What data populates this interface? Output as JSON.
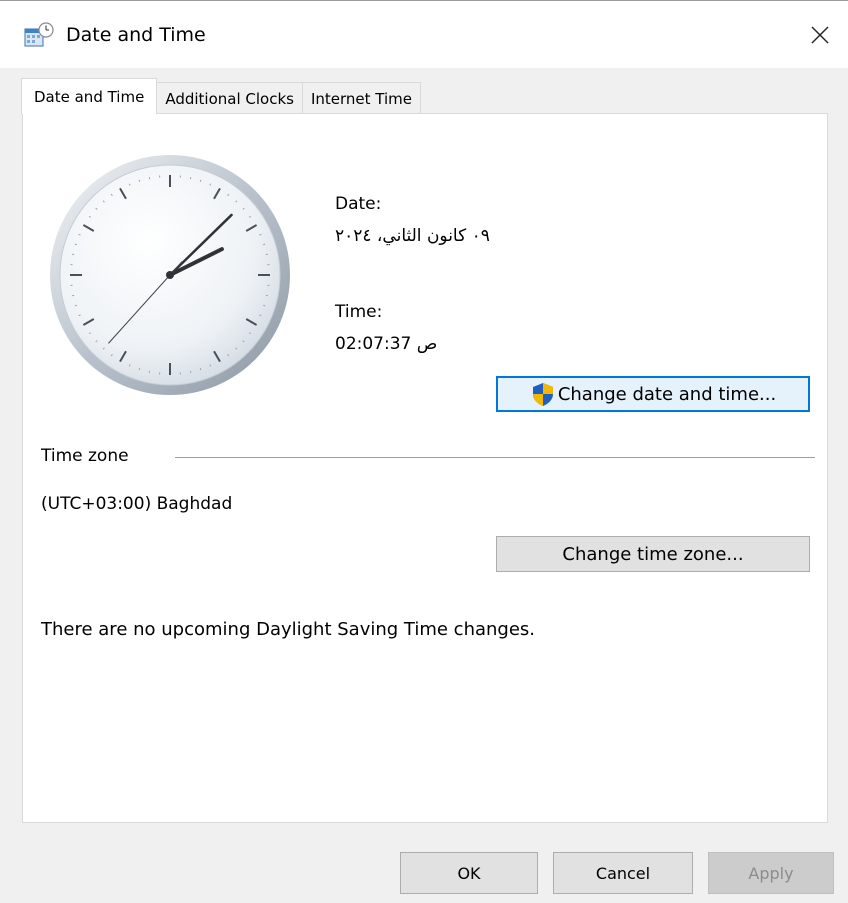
{
  "window": {
    "title": "Date and Time",
    "title_icon": "date-time-control-panel-icon",
    "close_icon": "close-icon"
  },
  "tabs": [
    {
      "label": "Date and Time",
      "active": true
    },
    {
      "label": "Additional Clocks",
      "active": false
    },
    {
      "label": "Internet Time",
      "active": false
    }
  ],
  "clock": {
    "hour": 2,
    "minute": 7,
    "second": 37
  },
  "date": {
    "label": "Date:",
    "value": "٠٩ كانون الثاني، ٢٠٢٤"
  },
  "time": {
    "label": "Time:",
    "value": "02:07:37 ص"
  },
  "buttons": {
    "change_date_time": "Change date and time...",
    "change_time_zone": "Change time zone...",
    "ok": "OK",
    "cancel": "Cancel",
    "apply": "Apply"
  },
  "timezone": {
    "header": "Time zone",
    "value": "(UTC+03:00) Baghdad"
  },
  "dst_message": "There are no upcoming Daylight Saving Time changes.",
  "colors": {
    "accent_border": "#0078d7",
    "accent_fill": "#e5f1fb",
    "shield_blue": "#1f5fbf",
    "shield_yellow": "#f5b800"
  }
}
